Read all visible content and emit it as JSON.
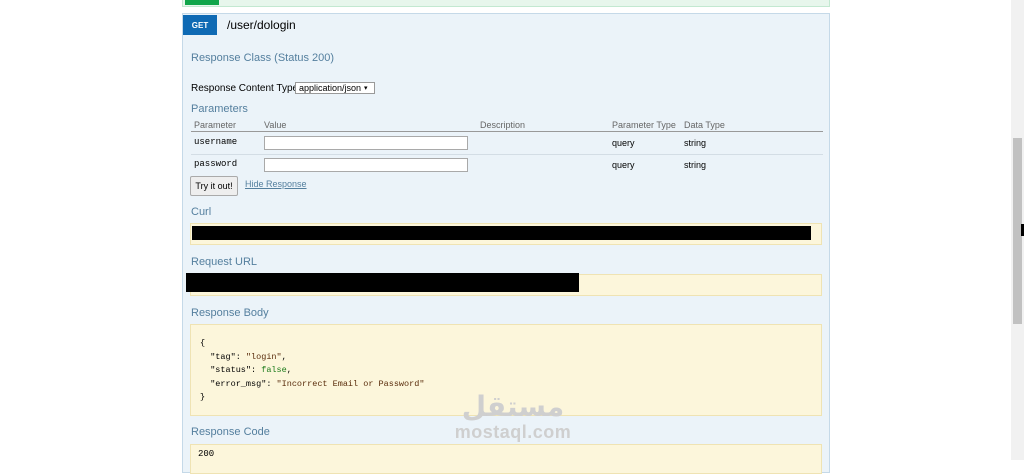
{
  "operation": {
    "method": "GET",
    "path": "/user/dologin"
  },
  "response_class": {
    "title": "Response Class (Status 200)",
    "content_type_label": "Response Content Type",
    "content_type_value": "application/json",
    "content_type_caret": "▾"
  },
  "parameters": {
    "title": "Parameters",
    "headers": [
      "Parameter",
      "Value",
      "Description",
      "Parameter Type",
      "Data Type"
    ],
    "rows": [
      {
        "name": "username",
        "value": "",
        "param_type": "query",
        "data_type": "string"
      },
      {
        "name": "password",
        "value": "",
        "param_type": "query",
        "data_type": "string"
      }
    ]
  },
  "actions": {
    "try_label": "Try it out!",
    "hide_label": "Hide Response"
  },
  "curl": {
    "title": "Curl"
  },
  "request_url": {
    "title": "Request URL"
  },
  "response_body": {
    "title": "Response Body",
    "open": "{",
    "tag_key": "\"tag\"",
    "tag_val": "\"login\"",
    "status_key": "\"status\"",
    "status_val": "false",
    "err_key": "\"error_msg\"",
    "err_val": "\"Incorrect Email or Password\"",
    "close": "}"
  },
  "response_code": {
    "title": "Response Code",
    "value": "200"
  },
  "watermark": {
    "arabic": "مستقل",
    "latin": "mostaql.com"
  },
  "colors": {
    "get": "#0f6ab4",
    "panel": "#ebf3f9",
    "code_bg": "#fcf6db"
  }
}
